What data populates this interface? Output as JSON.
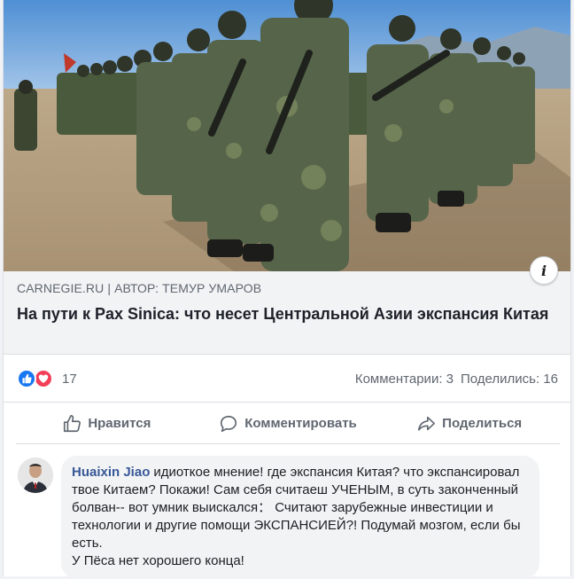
{
  "preview": {
    "image_alt": "soldiers-in-formation-photo",
    "info_icon": "i",
    "domain": "CARNEGIE.RU",
    "separator": "|",
    "author_line": "АВТОР: ТЕМУР УМАРОВ",
    "headline": "На пути к Pax Sinica: что несет Центральной Азии экспансия Китая"
  },
  "reactions": {
    "icons": [
      "like-icon",
      "love-icon"
    ],
    "count": "17",
    "comments_label": "Комментарии: 3",
    "shares_label": "Поделились: 16"
  },
  "actions": {
    "like": "Нравится",
    "comment": "Комментировать",
    "share": "Поделиться"
  },
  "comment": {
    "author": "Huaixin Jiao",
    "text": "идиоткое мнение! где экспансия Китая? что экспансировал твое Китаем? Покажи! Сам себя считаеш УЧЕНЫМ, в суть законченный болван-- вот умник выискался： Считают зарубежные инвестиции и технологии и другие помощи ЭКСПАНСИЕЙ?! Подумай мозгом, если бы есть.",
    "text_last_line": "У Пёса нет хорошего конца!"
  },
  "colors": {
    "link": "#385898",
    "like_blue": "#1877f2",
    "love_red": "#f33e58",
    "muted_text": "#606770",
    "preview_bg": "#f2f3f5"
  }
}
